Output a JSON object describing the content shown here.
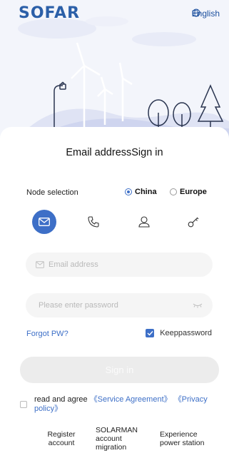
{
  "brand": {
    "logo_text": "SOFAR",
    "color": "#2b5fa8"
  },
  "header": {
    "language_label": "English",
    "language_icon": "globe-icon"
  },
  "login": {
    "title": "Email addressSign in",
    "node_selection_label": "Node selection",
    "nodes": [
      {
        "label": "China",
        "selected": true
      },
      {
        "label": "Europe",
        "selected": false
      }
    ],
    "tabs": [
      {
        "icon": "mail-icon",
        "active": true
      },
      {
        "icon": "phone-icon",
        "active": false
      },
      {
        "icon": "user-icon",
        "active": false
      },
      {
        "icon": "key-icon",
        "active": false
      }
    ],
    "email_placeholder": "Email address",
    "password_placeholder": "Please enter password",
    "forgot_label": "Forgot PW?",
    "keep_label": "Keeppassword",
    "keep_checked": true,
    "signin_label": "Sign in"
  },
  "agreement": {
    "prefix": "read and agree",
    "service_link": "《Service Agreement》",
    "privacy_link": "《Privacy policy》"
  },
  "footer_links": {
    "register": "Register account",
    "migration": "SOLARMAN account migration",
    "experience": "Experience power station"
  },
  "colors": {
    "accent": "#3d6fc7",
    "disabled_button": "#ececec",
    "hero_bg": "#f3f5fb"
  }
}
